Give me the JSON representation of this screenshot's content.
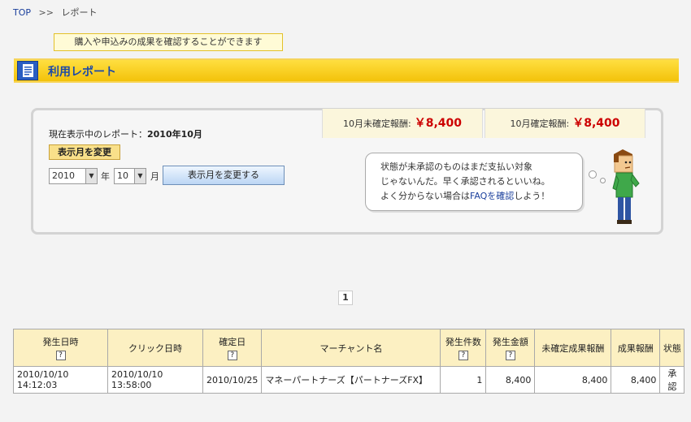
{
  "breadcrumb": {
    "top": "TOP",
    "separator": ">>",
    "current": "レポート"
  },
  "tooltip": "購入や申込みの成果を確認することができます",
  "section": {
    "title": "利用レポート"
  },
  "summary": {
    "current_report_label": "現在表示中のレポート：",
    "current_report_value": "2010年10月",
    "change_month_label": "表示月を変更",
    "year_value": "2010",
    "year_unit": "年",
    "month_value": "10",
    "month_unit": "月",
    "change_button": "表示月を変更する",
    "unconfirmed_label": "10月未確定報酬:",
    "unconfirmed_amount": "￥8,400",
    "confirmed_label": "10月確定報酬:",
    "confirmed_amount": "￥8,400",
    "bubble_line1": "状態が未承認のものはまだ支払い対象",
    "bubble_line2": "じゃないんだ。早く承認されるといいね。",
    "bubble_line3_pre": "よく分からない場合は",
    "bubble_link": "FAQを確認",
    "bubble_line3_post": "しよう！"
  },
  "pagination": {
    "current": "1"
  },
  "table": {
    "help_glyph": "?",
    "headers": [
      "発生日時",
      "クリック日時",
      "確定日",
      "マーチャント名",
      "発生件数",
      "発生金額",
      "未確定成果報酬",
      "成果報酬",
      "状態"
    ],
    "rows": [
      [
        "2010/10/10 14:12:03",
        "2010/10/10 13:58:00",
        "2010/10/25",
        "マネーパートナーズ【パートナーズFX】",
        "1",
        "8,400",
        "8,400",
        "8,400",
        "承認"
      ]
    ]
  },
  "colors": {
    "accent_blue": "#1e4aa6",
    "amount_red": "#cc0000",
    "header_yellow": "#f3c20a"
  }
}
